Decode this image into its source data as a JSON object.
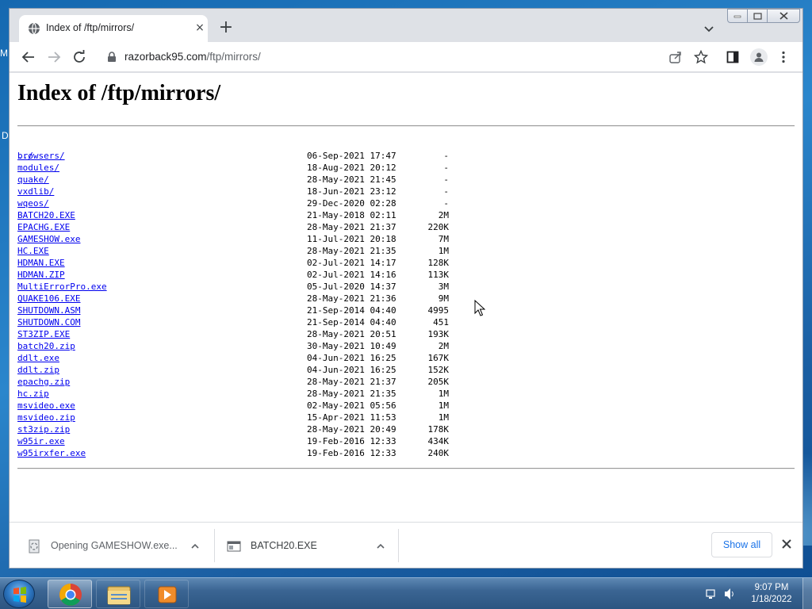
{
  "desktop": {
    "letters": [
      "M",
      "D"
    ]
  },
  "browser": {
    "tab": {
      "title": "Index of /ftp/mirrors/",
      "favicon": "globe-icon",
      "close": "×"
    },
    "new_tab": "+",
    "toolbar": {
      "url_host": "razorback95.com",
      "url_path": "/ftp/mirrors/"
    }
  },
  "page": {
    "heading": "Index of /ftp/mirrors/",
    "parent": "../",
    "entries": [
      {
        "name": "browsers/",
        "date": "06-Sep-2021 17:47",
        "size": "-"
      },
      {
        "name": "modules/",
        "date": "18-Aug-2021 20:12",
        "size": "-"
      },
      {
        "name": "quake/",
        "date": "28-May-2021 21:45",
        "size": "-"
      },
      {
        "name": "vxdlib/",
        "date": "18-Jun-2021 23:12",
        "size": "-"
      },
      {
        "name": "wqeos/",
        "date": "29-Dec-2020 02:28",
        "size": "-"
      },
      {
        "name": "BATCH20.EXE",
        "date": "21-May-2018 02:11",
        "size": "2M"
      },
      {
        "name": "EPACHG.EXE",
        "date": "28-May-2021 21:37",
        "size": "220K"
      },
      {
        "name": "GAMESHOW.exe",
        "date": "11-Jul-2021 20:18",
        "size": "7M"
      },
      {
        "name": "HC.EXE",
        "date": "28-May-2021 21:35",
        "size": "1M"
      },
      {
        "name": "HDMAN.EXE",
        "date": "02-Jul-2021 14:17",
        "size": "128K"
      },
      {
        "name": "HDMAN.ZIP",
        "date": "02-Jul-2021 14:16",
        "size": "113K"
      },
      {
        "name": "MultiErrorPro.exe",
        "date": "05-Jul-2020 14:37",
        "size": "3M"
      },
      {
        "name": "QUAKE106.EXE",
        "date": "28-May-2021 21:36",
        "size": "9M"
      },
      {
        "name": "SHUTDOWN.ASM",
        "date": "21-Sep-2014 04:40",
        "size": "4995"
      },
      {
        "name": "SHUTDOWN.COM",
        "date": "21-Sep-2014 04:40",
        "size": "451"
      },
      {
        "name": "ST3ZIP.EXE",
        "date": "28-May-2021 20:51",
        "size": "193K"
      },
      {
        "name": "batch20.zip",
        "date": "30-May-2021 10:49",
        "size": "2M"
      },
      {
        "name": "ddlt.exe",
        "date": "04-Jun-2021 16:25",
        "size": "167K"
      },
      {
        "name": "ddlt.zip",
        "date": "04-Jun-2021 16:25",
        "size": "152K"
      },
      {
        "name": "epachg.zip",
        "date": "28-May-2021 21:37",
        "size": "205K"
      },
      {
        "name": "hc.zip",
        "date": "28-May-2021 21:35",
        "size": "1M"
      },
      {
        "name": "msvideo.exe",
        "date": "02-May-2021 05:56",
        "size": "1M"
      },
      {
        "name": "msvideo.zip",
        "date": "15-Apr-2021 11:53",
        "size": "1M"
      },
      {
        "name": "st3zip.zip",
        "date": "28-May-2021 20:49",
        "size": "178K"
      },
      {
        "name": "w95ir.exe",
        "date": "19-Feb-2016 12:33",
        "size": "434K"
      },
      {
        "name": "w95irxfer.exe",
        "date": "19-Feb-2016 12:33",
        "size": "240K"
      }
    ]
  },
  "downloads": {
    "items": [
      {
        "label": "Opening GAMESHOW.exe...",
        "icon": "spinner-file-icon"
      },
      {
        "label": "BATCH20.EXE",
        "icon": "exe-file-icon"
      }
    ],
    "show_all": "Show all"
  },
  "taskbar": {
    "apps": [
      "chrome-icon",
      "explorer-folder-icon",
      "media-player-icon"
    ],
    "time": "9:07 PM",
    "date": "1/18/2022"
  },
  "colors": {
    "link": "#0000ee",
    "accent": "#1a73e8",
    "tab_strip": "#dee1e6"
  }
}
